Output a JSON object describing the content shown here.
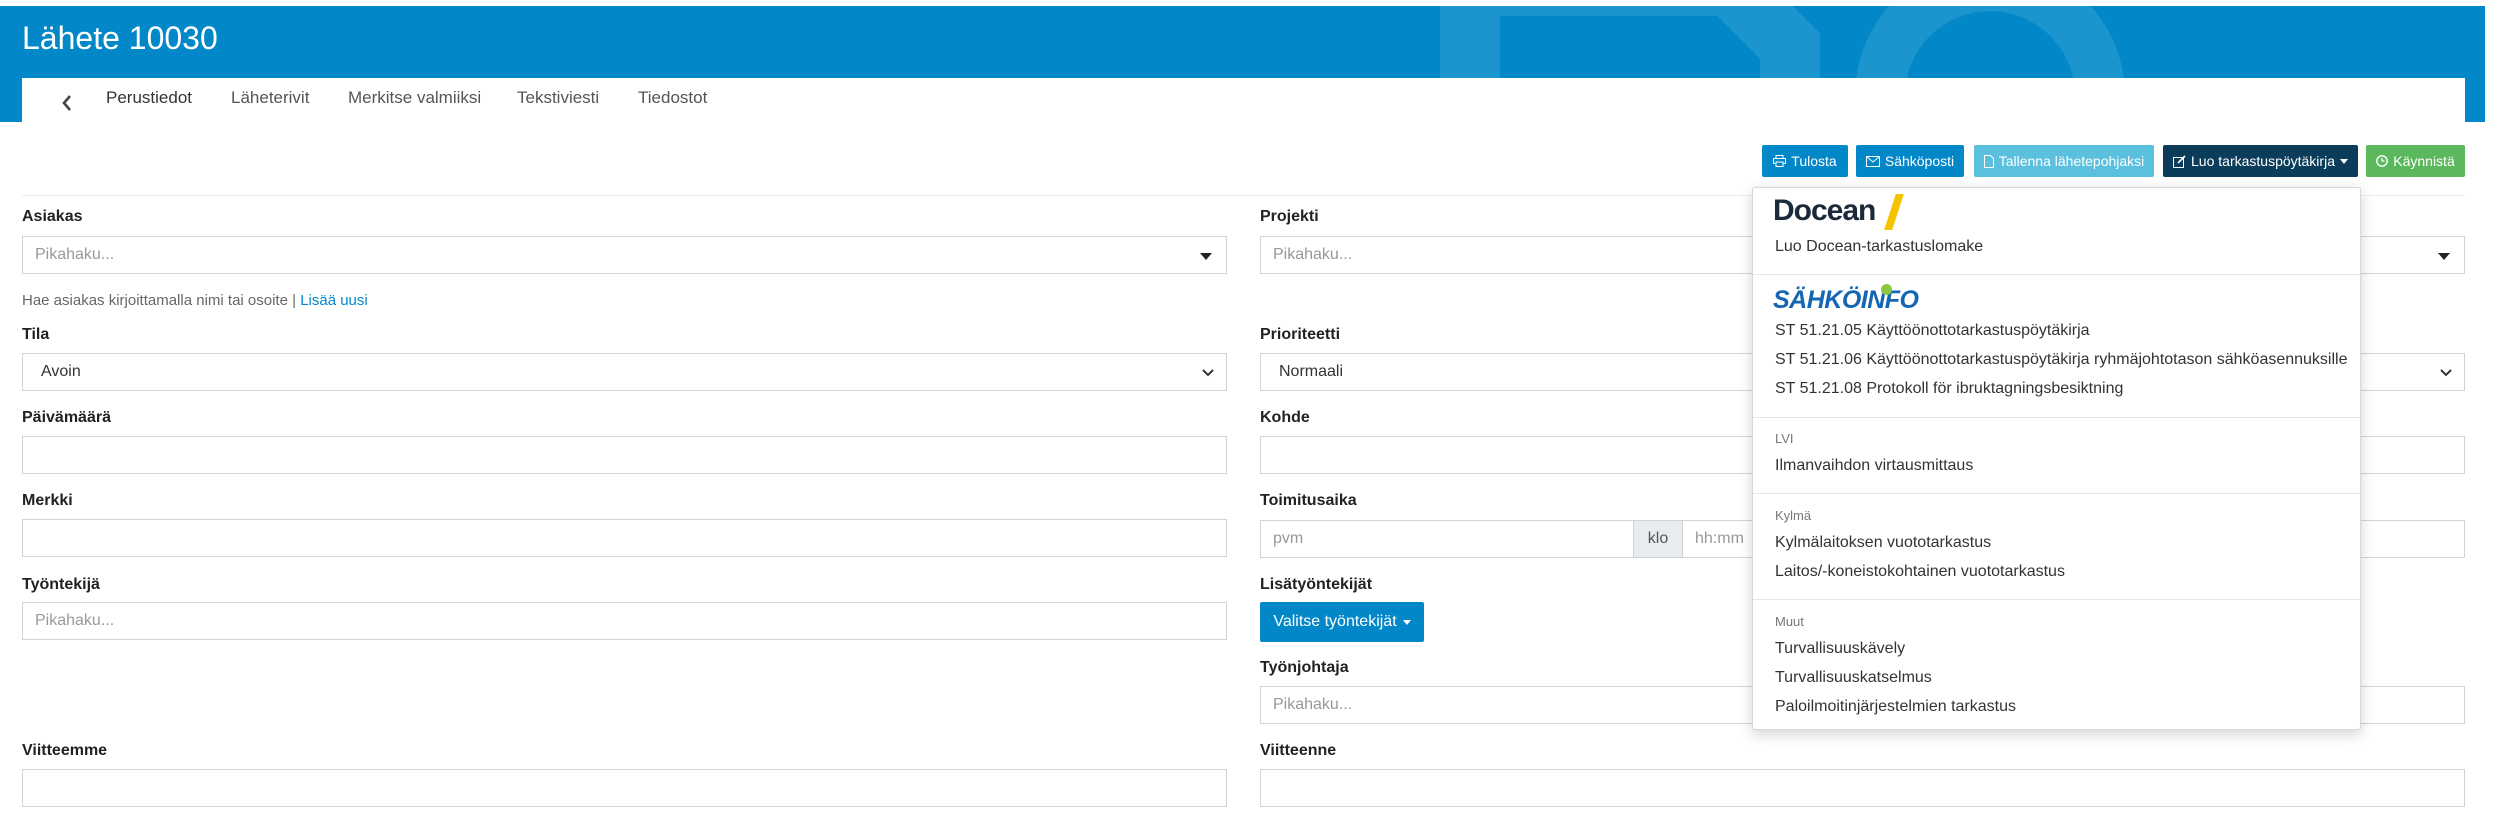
{
  "page": {
    "title": "Lähete 10030"
  },
  "tabs": {
    "back_icon": "chevron-left-icon",
    "items": [
      {
        "label": "Perustiedot",
        "active": true
      },
      {
        "label": "Läheterivit"
      },
      {
        "label": "Merkitse valmiiksi"
      },
      {
        "label": "Tekstiviesti"
      },
      {
        "label": "Tiedostot"
      }
    ]
  },
  "toolbar": {
    "print": "Tulosta",
    "email": "Sähköposti",
    "save_template": "Tallenna lähetepohjaksi",
    "create_report": "Luo tarkastuspöytäkirja",
    "start": "Käynnistä"
  },
  "form": {
    "customer": {
      "label": "Asiakas",
      "placeholder": "Pikahaku...",
      "hint": "Hae asiakas kirjoittamalla nimi tai osoite |",
      "add_new": "Lisää uusi"
    },
    "project": {
      "label": "Projekti",
      "placeholder": "Pikahaku..."
    },
    "status": {
      "label": "Tila",
      "value": "Avoin"
    },
    "priority": {
      "label": "Prioriteetti",
      "value": "Normaali"
    },
    "date": {
      "label": "Päivämäärä",
      "value": ""
    },
    "target": {
      "label": "Kohde",
      "value": ""
    },
    "mark": {
      "label": "Merkki",
      "value": ""
    },
    "delivery_time": {
      "label": "Toimitusaika",
      "date_placeholder": "pvm",
      "clock_label": "klo",
      "time_placeholder": "hh:mm"
    },
    "worker": {
      "label": "Työntekijä",
      "placeholder": "Pikahaku..."
    },
    "extra_workers": {
      "label": "Lisätyöntekijät",
      "button": "Valitse työntekijät"
    },
    "supervisor": {
      "label": "Työnjohtaja",
      "placeholder": "Pikahaku..."
    },
    "our_reference": {
      "label": "Viitteemme",
      "value": ""
    },
    "your_reference": {
      "label": "Viitteenne",
      "value": ""
    }
  },
  "dropdown": {
    "docean": {
      "logo": "Docean",
      "items": [
        "Luo Docean-tarkastuslomake"
      ]
    },
    "sahkoinfo": {
      "logo": "SÄHKÖINFO",
      "items": [
        "ST 51.21.05 Käyttöönottotarkastuspöytäkirja",
        "ST 51.21.06 Käyttöönottotarkastuspöytäkirja ryhmäjohtotason sähköasennuksille",
        "ST 51.21.08 Protokoll för ibruktagningsbesiktning"
      ]
    },
    "lvi": {
      "heading": "LVI",
      "items": [
        "Ilmanvaihdon virtausmittaus"
      ]
    },
    "kylma": {
      "heading": "Kylmä",
      "items": [
        "Kylmälaitoksen vuototarkastus",
        "Laitos/-koneistokohtainen vuototarkastus"
      ]
    },
    "muut": {
      "heading": "Muut",
      "items": [
        "Turvallisuuskävely",
        "Turvallisuuskatselmus",
        "Paloilmoitinjärjestelmien tarkastus"
      ]
    }
  }
}
